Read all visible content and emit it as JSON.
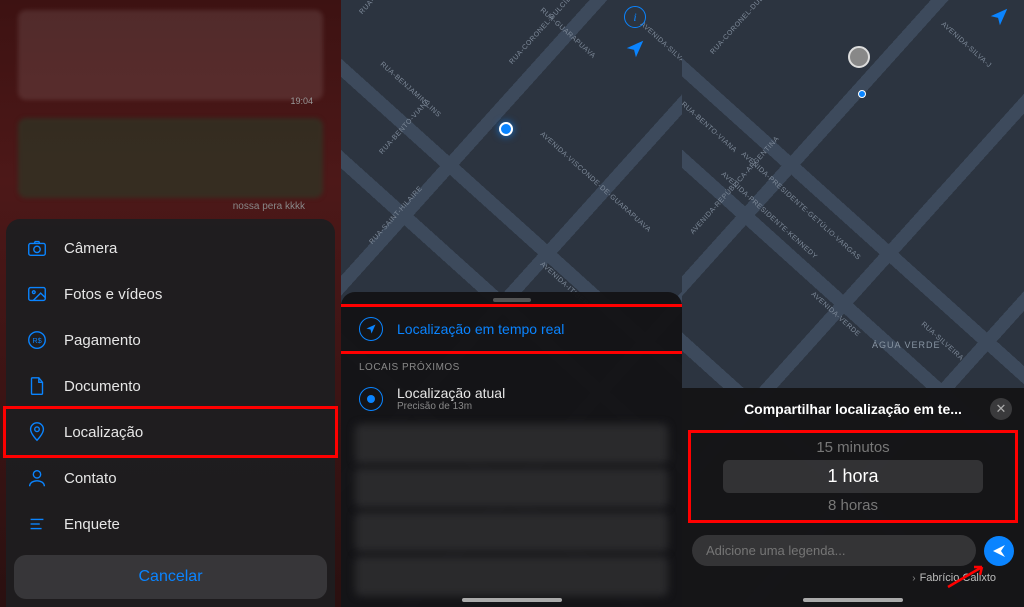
{
  "left": {
    "timestamp": "19:04",
    "chat_hint": "nossa pera kkkk",
    "menu": [
      {
        "label": "Câmera"
      },
      {
        "label": "Fotos e vídeos"
      },
      {
        "label": "Pagamento"
      },
      {
        "label": "Documento"
      },
      {
        "label": "Localização"
      },
      {
        "label": "Contato"
      },
      {
        "label": "Enquete"
      }
    ],
    "cancel": "Cancelar"
  },
  "middle": {
    "streets": {
      "a": "RUA-DO-BATEL",
      "b": "RUA-CORONEL-DULCÍDIO",
      "c": "RUA-BENTO-VIANA",
      "d": "RUA-SAINT-HILAIRE",
      "e": "RUA-BENJAMIN-LINS",
      "f": "RUA-GUARAPUAVA",
      "g": "AVENIDA-SILVA-J",
      "h": "AVENIDA-VISCONDE-DE-GUARAPUAVA",
      "i": "AVENIDA-ITIBERÊ"
    },
    "realtime": "Localização em tempo real",
    "nearby_header": "LOCAIS PRÓXIMOS",
    "current_title": "Localização atual",
    "current_sub": "Precisão de 13m"
  },
  "right": {
    "streets": {
      "a": "RUA-CORONEL-DULCÍDIO",
      "b": "AVENIDA-PRESIDENTE-GETÚLIO-VARGAS",
      "c": "AVENIDA-REPÚBLICA-ARGENTINA",
      "d": "RUA-BENTO-VIANA",
      "e": "AVENIDA-SILVA-J",
      "f": "AVENIDA-PRESIDENTE-KENNEDY",
      "g": "AVENIDA-VERDE",
      "h": "RUA-SILVEIRA"
    },
    "area": "ÁGUA VERDE",
    "share_title": "Compartilhar localização em te...",
    "picker": {
      "opt1": "15 minutos",
      "opt2": "1 hora",
      "opt3": "8 horas"
    },
    "caption_placeholder": "Adicione uma legenda...",
    "credit": "Fabrício Calixto"
  }
}
